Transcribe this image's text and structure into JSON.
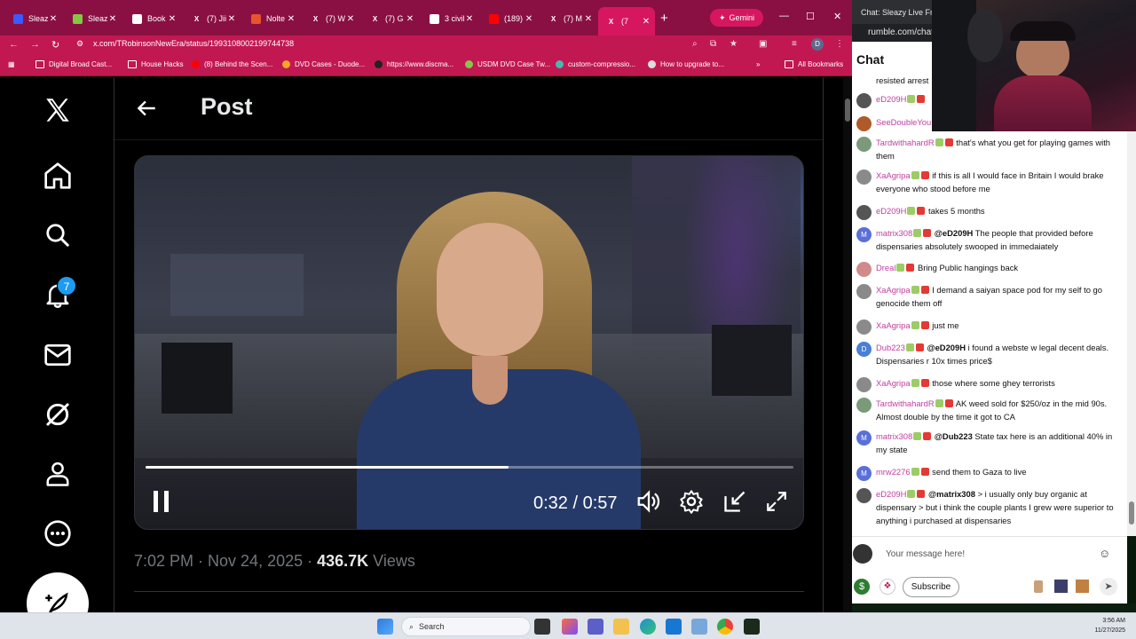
{
  "browser": {
    "tabs": [
      {
        "label": "Sleaz",
        "icon": "rumble-icon",
        "color": "#3d5afe"
      },
      {
        "label": "Sleaz",
        "icon": "rumble-play-icon",
        "color": "#85c742"
      },
      {
        "label": "Book",
        "icon": "star-icon",
        "color": "#ffffff"
      },
      {
        "label": "(7) Jii",
        "icon": "x-logo-icon",
        "color": "#000000"
      },
      {
        "label": "Nolte",
        "icon": "breitbart-icon",
        "color": "#e8542e"
      },
      {
        "label": "(7) W",
        "icon": "x-logo-icon",
        "color": "#000000"
      },
      {
        "label": "(7) G",
        "icon": "x-logo-icon",
        "color": "#000000"
      },
      {
        "label": "3 civil",
        "icon": "google-icon",
        "color": "#ffffff"
      },
      {
        "label": "(189)",
        "icon": "youtube-icon",
        "color": "#ff0000"
      },
      {
        "label": "(7) M",
        "icon": "x-logo-icon",
        "color": "#000000"
      },
      {
        "label": "(7",
        "icon": "x-logo-icon",
        "color": "#000000"
      }
    ],
    "gemini_label": "Gemini",
    "url": "x.com/TRobinsonNewEra/status/1993108002199744738",
    "bookmarks": [
      "Digital Broad Cast...",
      "House Hacks",
      "(8) Behind the Scen...",
      "DVD Cases - Duode...",
      "https://www.discma...",
      "USDM DVD Case Tw...",
      "custom-compressio...",
      "How to upgrade to..."
    ],
    "all_bookmarks": "All Bookmarks",
    "brand_color": "#c11852"
  },
  "x": {
    "page_title": "Post",
    "notification_count": "7",
    "video": {
      "time": "0:32 / 0:57",
      "progress": 0.56
    },
    "post_time": "7:02 PM · Nov 24, 2025 · ",
    "views_count": "436.7K",
    "views_label": " Views"
  },
  "taskbar": {
    "search_placeholder": "Search",
    "time": "3:56 AM",
    "date": "11/27/2025"
  },
  "rumble": {
    "window_title": "Chat: Sleazy Live From...",
    "url": "rumble.com/chat",
    "chat_title": "Chat",
    "messages": [
      {
        "user": "",
        "text": "resisted arrest",
        "av": "#666666"
      },
      {
        "user": "eD209H",
        "text": "",
        "av": "#555555"
      },
      {
        "user": "SeeDoubleYou",
        "text": "",
        "av": "#b05a2a"
      },
      {
        "user": "TardwithahardR",
        "text": "that's what you get for playing games with them",
        "av": "#7a9a7a"
      },
      {
        "user": "XaAgripa",
        "text": "if this is all I would face in Britain I would brake everyone who stood before me",
        "av": "#8a8a8a"
      },
      {
        "user": "eD209H",
        "text": "takes 5 months",
        "av": "#555555"
      },
      {
        "user": "matrix308",
        "mention": "@eD209H",
        "text": "The people that provided before dispensaries absolutely swooped in immedaiately",
        "av": "#5a6fd8",
        "letter": "M"
      },
      {
        "user": "Dreal",
        "text": "Bring Public hangings back",
        "av": "#d08a8a"
      },
      {
        "user": "XaAgripa",
        "text": "I demand a saiyan space pod for my self to go genocide them off",
        "av": "#8a8a8a"
      },
      {
        "user": "XaAgripa",
        "text": "just me",
        "av": "#8a8a8a"
      },
      {
        "user": "Dub223",
        "mention": "@eD209H",
        "text": "i found a webste w legal decent deals. Dispensaries r 10x times price$",
        "av": "#4a7fd6",
        "letter": "D"
      },
      {
        "user": "XaAgripa",
        "text": "those where some ghey terrorists",
        "av": "#8a8a8a"
      },
      {
        "user": "TardwithahardR",
        "text": "AK weed sold for $250/oz in the mid 90s. Almost double by the time it got to CA",
        "av": "#7a9a7a"
      },
      {
        "user": "matrix308",
        "mention": "@Dub223",
        "text": "State tax here is an additional 40% in my state",
        "av": "#5a6fd8",
        "letter": "M"
      },
      {
        "user": "mrw2276",
        "text": "send them to Gaza to live",
        "av": "#5a6fd8",
        "letter": "M"
      },
      {
        "user": "eD209H",
        "mention": "@matrix308",
        "text": "> i usually only buy organic at dispensary > but i think the couple plants I grew were superior to anything i purchased at dispensaries",
        "av": "#555555"
      }
    ],
    "input_placeholder": "Your message here!",
    "subscribe_label": "Subscribe",
    "username_color": "#c040a0"
  }
}
